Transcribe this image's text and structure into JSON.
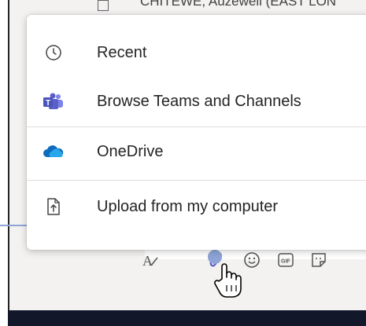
{
  "header": {
    "partial_title": "CHITEWE, Auzewell (EAST LON"
  },
  "attach_menu": {
    "items": [
      {
        "label": "Recent",
        "icon": "clock-icon"
      },
      {
        "label": "Browse Teams and Channels",
        "icon": "teams-icon"
      },
      {
        "label": "OneDrive",
        "icon": "onedrive-cloud-icon"
      },
      {
        "label": "Upload from my computer",
        "icon": "upload-file-icon"
      }
    ]
  },
  "compose_toolbar": {
    "icons": [
      "format-icon",
      "attach-icon",
      "emoji-icon",
      "gif-icon",
      "sticker-icon"
    ]
  },
  "colors": {
    "teams_purple": "#5b5fc7",
    "onedrive_blue": "#0f6cbd",
    "callout": "#8ea4d6",
    "bottom_bar": "#13172a"
  }
}
